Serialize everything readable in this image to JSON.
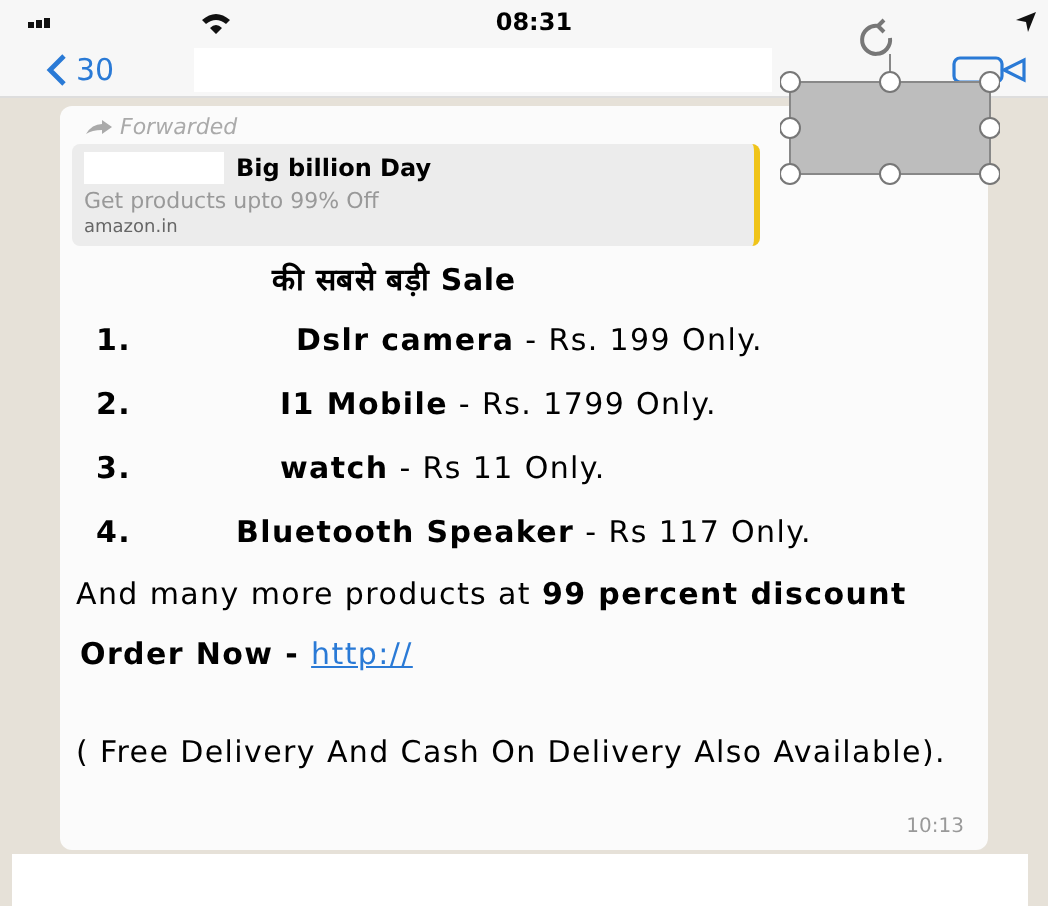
{
  "status_bar": {
    "time": "08:31"
  },
  "nav": {
    "back_count": "30"
  },
  "message": {
    "forwarded_label": "Forwarded",
    "preview": {
      "title": "Big billion Day",
      "description": "Get products upto 99% Off",
      "domain": "amazon.in"
    },
    "headline": "की सबसे बड़ी Sale",
    "items": [
      {
        "number": "1.",
        "name": "Dslr camera",
        "price": " - Rs. 199 Only."
      },
      {
        "number": "2.",
        "name": "I1 Mobile",
        "price": " - Rs. 1799 Only."
      },
      {
        "number": "3.",
        "name": "watch",
        "price": "  - Rs 11 Only."
      },
      {
        "number": "4.",
        "name": "Bluetooth Speaker",
        "price": " - Rs 117 Only."
      }
    ],
    "more": "And many more products at **99 percent discount**",
    "order_label": "Order Now -",
    "link": "http://",
    "note": "( Free Delivery And Cash On Delivery Also Available).",
    "time": "10:13"
  }
}
